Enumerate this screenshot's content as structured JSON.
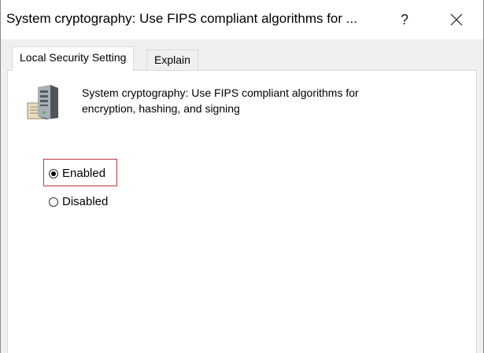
{
  "window": {
    "title": "System cryptography: Use FIPS compliant algorithms for ...",
    "help_label": "?",
    "close_icon": "close-icon"
  },
  "tabs": [
    {
      "label": "Local Security Setting",
      "active": true
    },
    {
      "label": "Explain",
      "active": false
    }
  ],
  "policy": {
    "icon": "server-policy-icon",
    "description_line1": "System cryptography: Use FIPS compliant algorithms for",
    "description_line2": "encryption, hashing, and signing"
  },
  "options": [
    {
      "label": "Enabled",
      "selected": true
    },
    {
      "label": "Disabled",
      "selected": false
    }
  ],
  "colors": {
    "highlight_border": "#c0393b",
    "window_background": "#f0f0f0",
    "panel_background": "#ffffff"
  }
}
